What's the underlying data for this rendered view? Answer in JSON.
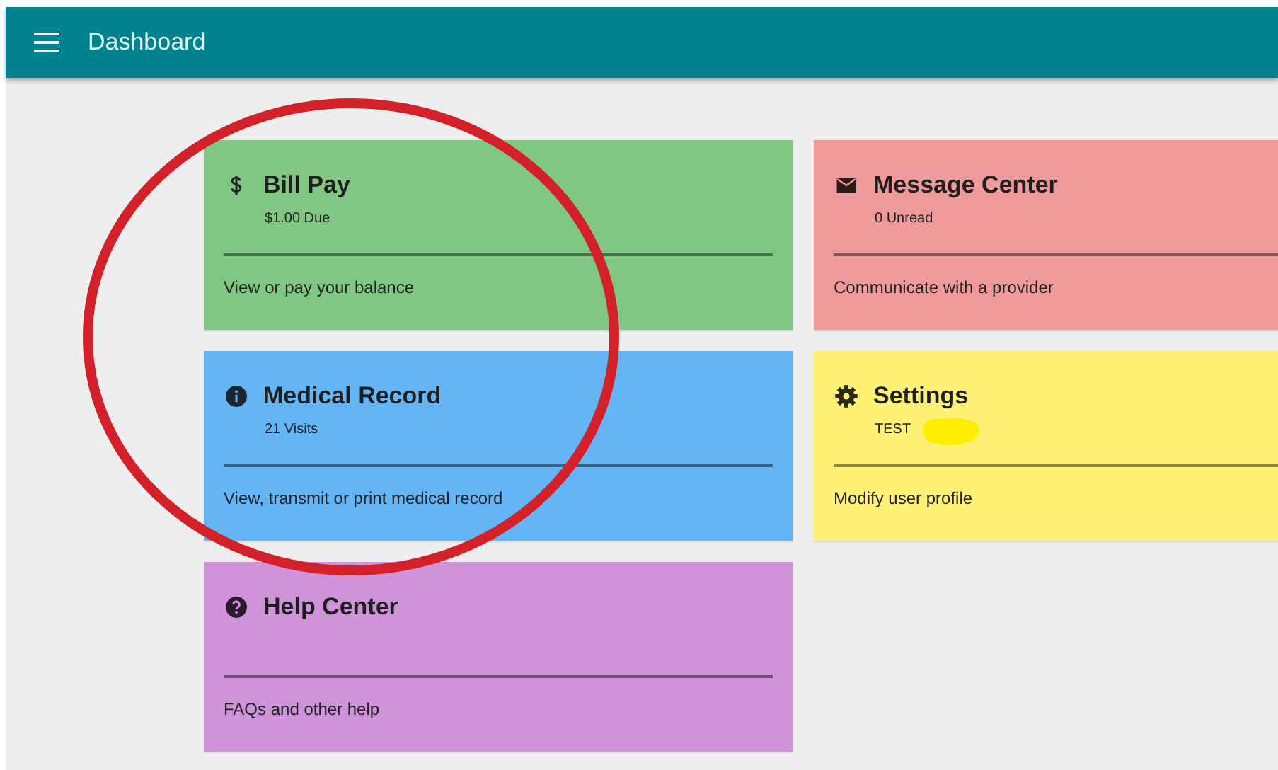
{
  "app_bar": {
    "title": "Dashboard"
  },
  "cards": [
    {
      "kind": "dollar",
      "title": "Bill Pay",
      "subtitle": "$1.00 Due",
      "description": "View or pay your balance",
      "color": "#81c784",
      "redacted": false
    },
    {
      "kind": "mail",
      "title": "Message Center",
      "subtitle": "0 Unread",
      "description": "Communicate with a provider",
      "color": "#ef9a9a",
      "redacted": false
    },
    {
      "kind": "info",
      "title": "Medical Record",
      "subtitle": "21 Visits",
      "description": "View, transmit or print medical record",
      "color": "#64b5f6",
      "redacted": false
    },
    {
      "kind": "gear",
      "title": "Settings",
      "subtitle": "TEST",
      "description": "Modify user profile",
      "color": "#fff176",
      "redacted": true
    },
    {
      "kind": "help",
      "title": "Help Center",
      "description": "FAQs and other help",
      "color": "#ce93d8",
      "redacted": false
    }
  ],
  "annotation": {
    "kind": "circle",
    "color": "#d32029"
  }
}
